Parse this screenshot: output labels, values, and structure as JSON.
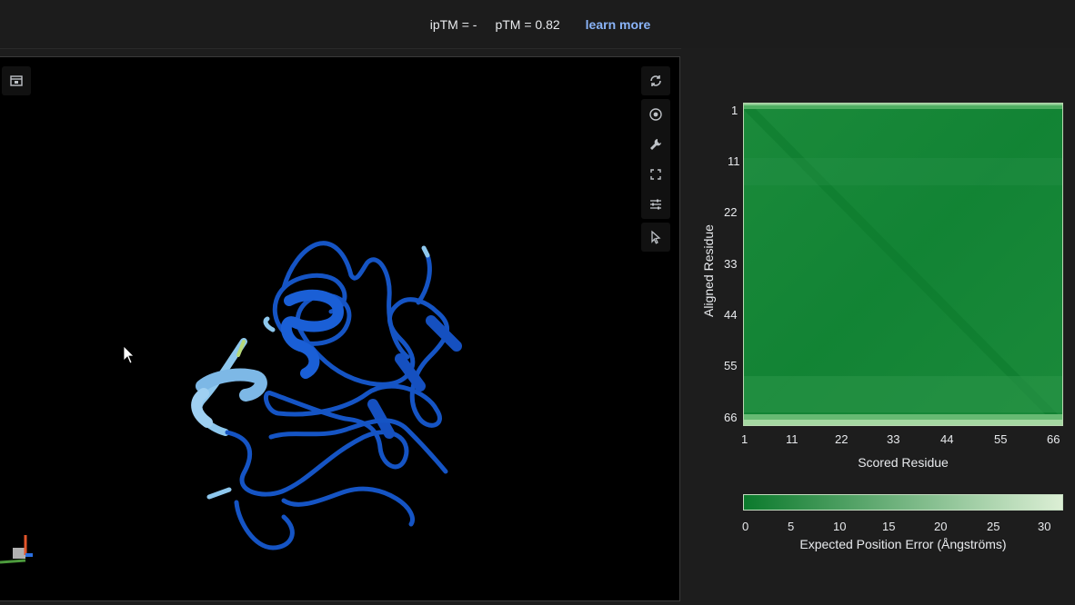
{
  "header": {
    "iptm": "ipTM = -",
    "ptm": "pTM = 0.82",
    "learn_more": "learn more"
  },
  "viewer": {
    "left_tool_icon": "layout-icon",
    "right_tools": [
      "sync-icon",
      "camera-icon",
      "wrench-icon",
      "fullscreen-icon",
      "sliders-icon",
      "cursor-icon"
    ]
  },
  "pae": {
    "y_axis_label": "Aligned Residue",
    "x_axis_label": "Scored Residue",
    "ticks": [
      "1",
      "11",
      "22",
      "33",
      "44",
      "55",
      "66"
    ],
    "colorbar_ticks": [
      "0",
      "5",
      "10",
      "15",
      "20",
      "25",
      "30"
    ],
    "colorbar_label": "Expected Position Error (Ångströms)",
    "colors": {
      "low": "#0b7a2c",
      "high": "#dcefd5"
    }
  }
}
